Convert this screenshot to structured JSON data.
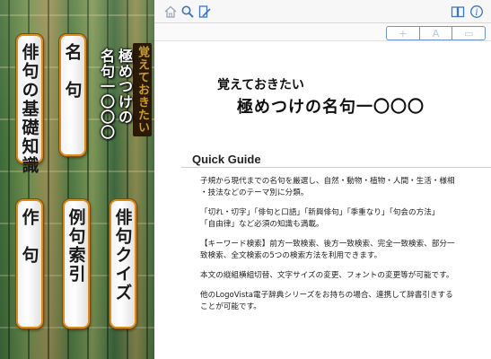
{
  "menu": {
    "title_sub": "覚えておきたい",
    "title_line1": "極めつけの",
    "title_line2": "名句一〇〇〇",
    "buttons": {
      "kiso": "俳句の基礎知識",
      "meiku": "名　句",
      "sakku": "作　句",
      "reiku": "例句索引",
      "quiz": "俳句クイズ"
    }
  },
  "toolbar": {
    "icons": [
      "home-icon",
      "search-icon",
      "bookmark-edit-icon",
      "book-icon",
      "info-icon"
    ],
    "segment_labels": [
      "+",
      "A",
      "▭"
    ]
  },
  "content": {
    "heading_sub": "覚えておきたい",
    "heading_main": "極めつけの名句一〇〇〇",
    "guide_title": "Quick Guide",
    "paragraphs": [
      "子規から現代までの名句を厳選し、自然・動物・植物・人間・生活・様相\n・技法などのテーマ別に分類。",
      "「切れ・切字」「俳句と口語」「新興俳句」「季重なり」「句会の方法」\n「自由律」など必須の知識も満載。",
      "【キーワード検索】前方一致検索、後方一致検索、完全一致検索、部分一\n致検索、全文検索の5つの検索方法を利用できます。",
      "本文の縦組横組切替、文字サイズの変更、フォントの変更等が可能です。",
      "他のLogoVista電子辞典シリーズをお持ちの場合、連携して辞書引きする\nことが可能です。"
    ]
  }
}
